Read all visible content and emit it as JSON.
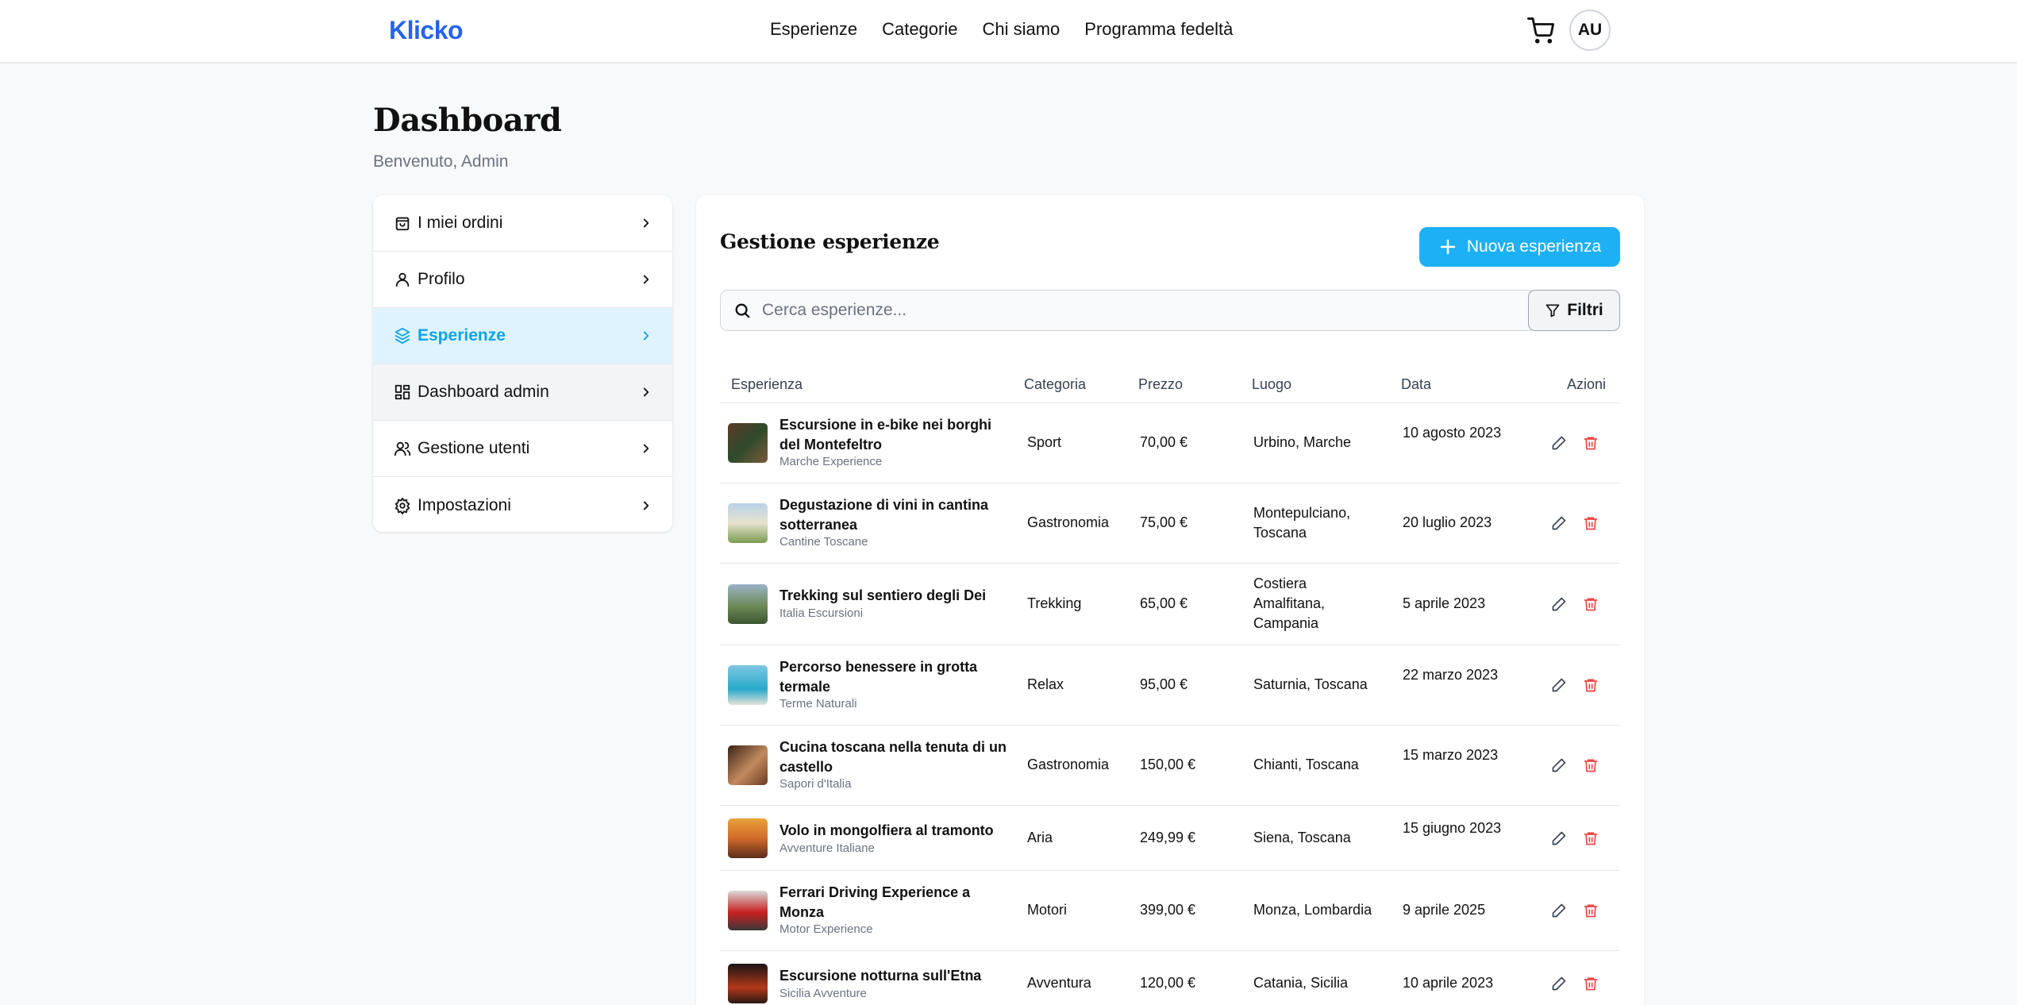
{
  "header": {
    "logo": "Klicko",
    "nav": [
      "Esperienze",
      "Categorie",
      "Chi siamo",
      "Programma fedeltà"
    ],
    "avatar": "AU",
    "brand_color": "#2563eb"
  },
  "page": {
    "title": "Dashboard",
    "subtitle": "Benvenuto, Admin"
  },
  "sidebar": {
    "items": [
      {
        "label": "I miei ordini",
        "icon": "bag-icon"
      },
      {
        "label": "Profilo",
        "icon": "user-icon"
      },
      {
        "label": "Esperienze",
        "icon": "box-icon"
      },
      {
        "label": "Dashboard admin",
        "icon": "grid-icon"
      },
      {
        "label": "Gestione utenti",
        "icon": "users-icon"
      },
      {
        "label": "Impostazioni",
        "icon": "gear-icon"
      }
    ],
    "active_index": 2,
    "active_color": "#0ea5e9"
  },
  "panel": {
    "title": "Gestione esperienze",
    "new_button": "Nuova esperienza",
    "search_placeholder": "Cerca esperienze...",
    "filter_button": "Filtri",
    "columns": [
      "Esperienza",
      "Categoria",
      "Prezzo",
      "Luogo",
      "Data",
      "Azioni"
    ],
    "rows": [
      {
        "name": "Escursione in e-bike nei borghi del Montefeltro",
        "org": "Marche Experience",
        "category": "Sport",
        "price": "70,00 €",
        "location": "Urbino, Marche",
        "date": "10 agosto 2023"
      },
      {
        "name": "Degustazione di vini in cantina sotterranea",
        "org": "Cantine Toscane",
        "category": "Gastronomia",
        "price": "75,00 €",
        "location": "Montepulciano, Toscana",
        "date": "20 luglio 2023"
      },
      {
        "name": "Trekking sul sentiero degli Dei",
        "org": "Italia Escursioni",
        "category": "Trekking",
        "price": "65,00 €",
        "location": "Costiera Amalfitana, Campania",
        "date": "5 aprile 2023"
      },
      {
        "name": "Percorso benessere in grotta termale",
        "org": "Terme Naturali",
        "category": "Relax",
        "price": "95,00 €",
        "location": "Saturnia, Toscana",
        "date": "22 marzo 2023"
      },
      {
        "name": "Cucina toscana nella tenuta di un castello",
        "org": "Sapori d'Italia",
        "category": "Gastronomia",
        "price": "150,00 €",
        "location": "Chianti, Toscana",
        "date": "15 marzo 2023"
      },
      {
        "name": "Volo in mongolfiera al tramonto",
        "org": "Avventure Italiane",
        "category": "Aria",
        "price": "249,99 €",
        "location": "Siena, Toscana",
        "date": "15 giugno 2023"
      },
      {
        "name": "Ferrari Driving Experience a Monza",
        "org": "Motor Experience",
        "category": "Motori",
        "price": "399,00 €",
        "location": "Monza, Lombardia",
        "date": "9 aprile 2025"
      },
      {
        "name": "Escursione notturna sull'Etna",
        "org": "Sicilia Avventure",
        "category": "Avventura",
        "price": "120,00 €",
        "location": "Catania, Sicilia",
        "date": "10 aprile 2023"
      }
    ]
  }
}
